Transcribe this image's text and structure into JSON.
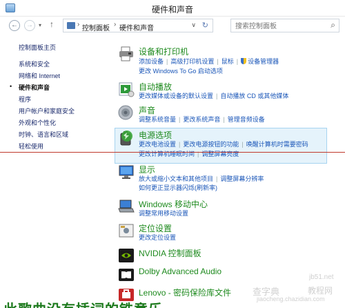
{
  "window": {
    "title": "硬件和声音"
  },
  "nav": {
    "back_glyph": "←",
    "forward_glyph": "→",
    "history_glyph": "▾",
    "up_glyph": "↑",
    "breadcrumb": [
      "控制面板",
      "硬件和声音"
    ],
    "breadcrumb_sep": "›",
    "dropdown_glyph": "∨",
    "refresh_glyph": "↻",
    "search_placeholder": "搜索控制面板",
    "search_glyph": "⌕"
  },
  "sidebar": {
    "items": [
      {
        "label": "控制面板主页"
      },
      {
        "label": "系统和安全"
      },
      {
        "label": "网络和 Internet"
      },
      {
        "label": "硬件和声音",
        "active": true
      },
      {
        "label": "程序"
      },
      {
        "label": "用户帐户和家庭安全"
      },
      {
        "label": "外观和个性化"
      },
      {
        "label": "时钟、语言和区域"
      },
      {
        "label": "轻松使用"
      }
    ],
    "active_marker": "•"
  },
  "categories": [
    {
      "title": "设备和打印机",
      "icon": "printer-icon",
      "rows": [
        [
          "添加设备",
          "高级打印机设置",
          "鼠标",
          "设备管理器"
        ],
        [
          "更改 Windows To Go 启动选项"
        ]
      ]
    },
    {
      "title": "自动播放",
      "icon": "autoplay-icon",
      "rows": [
        [
          "更改媒体或设备的默认设置",
          "自动播放 CD 或其他媒体"
        ]
      ]
    },
    {
      "title": "声音",
      "icon": "speaker-icon",
      "rows": [
        [
          "调整系统音量",
          "更改系统声音",
          "管理音频设备"
        ]
      ]
    },
    {
      "title": "电源选项",
      "icon": "power-options-icon",
      "rows": [
        [
          "更改电池设置",
          "更改电源按钮的功能",
          "唤醒计算机时需要密码"
        ],
        [
          "更改计算机睡眠时间",
          "调整屏幕亮度"
        ]
      ]
    },
    {
      "title": "显示",
      "icon": "display-icon",
      "rows": [
        [
          "放大或缩小文本和其他项目",
          "调整屏幕分辨率"
        ],
        [
          "如何更正显示器闪烁(刷新率)"
        ]
      ]
    },
    {
      "title": "Windows 移动中心",
      "icon": "mobility-center-icon",
      "rows": [
        [
          "调整常用移动设置"
        ]
      ]
    },
    {
      "title": "定位设置",
      "icon": "location-icon",
      "rows": [
        [
          "更改定位设置"
        ]
      ]
    },
    {
      "title": "NVIDIA 控制面板",
      "icon": "nvidia-icon",
      "rows": []
    },
    {
      "title": "Dolby Advanced Audio",
      "icon": "dolby-icon",
      "rows": []
    },
    {
      "title": "Lenovo - 密码保险库文件",
      "icon": "lenovo-icon",
      "rows": []
    }
  ],
  "overlay": {
    "bottom_caption": " 此歌曲没有插词的铁意乐",
    "watermark_left": "查字典",
    "watermark_right": "教程网",
    "watermark_site": "jiaocheng.chazidian.com",
    "watermark_logo": "jb51.net"
  },
  "colors": {
    "category_title": "#1e8a1e",
    "link": "#1a56b8",
    "highlight_bg": "#e5f3fb",
    "highlight_border": "#a6d3f0",
    "annotation_line": "#c0392b"
  }
}
